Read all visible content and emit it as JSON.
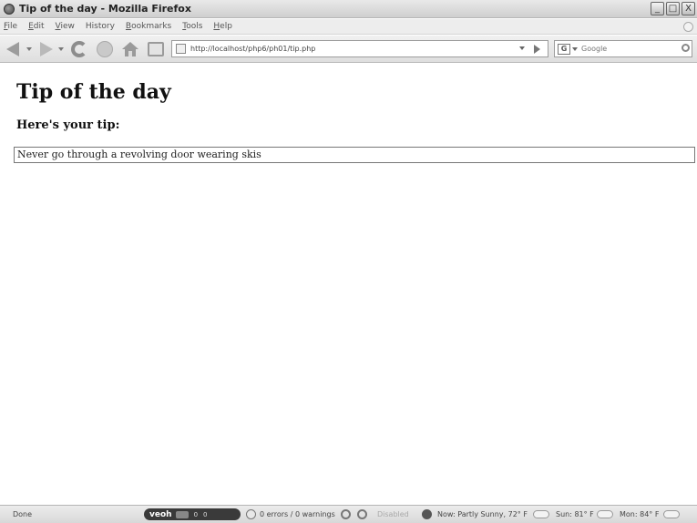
{
  "window": {
    "title": "Tip of the day - Mozilla Firefox",
    "minimize_glyph": "_",
    "maximize_glyph": "□",
    "close_glyph": "X"
  },
  "menu": {
    "items": [
      {
        "accel": "F",
        "rest": "ile"
      },
      {
        "accel": "E",
        "rest": "dit"
      },
      {
        "accel": "V",
        "rest": "iew"
      },
      {
        "accel": "",
        "rest": "History"
      },
      {
        "accel": "B",
        "rest": "ookmarks"
      },
      {
        "accel": "T",
        "rest": "ools"
      },
      {
        "accel": "H",
        "rest": "elp"
      }
    ]
  },
  "toolbar": {
    "url": "http://localhost/php6/ph01/tip.php",
    "search_engine_glyph": "G",
    "search_placeholder": "Google"
  },
  "page": {
    "heading": "Tip of the day",
    "subheading": "Here's your tip:",
    "tip_text": "Never go through a revolving door wearing skis"
  },
  "status": {
    "text": "Done",
    "veoh_logo": "veoh",
    "veoh_count_a": "0",
    "veoh_count_b": "0",
    "errors": "0 errors / 0 warnings",
    "disabled": "Disabled",
    "weather_now": "Now: Partly Sunny, 72° F",
    "weather_sun": "Sun: 81° F",
    "weather_mon": "Mon: 84° F"
  }
}
